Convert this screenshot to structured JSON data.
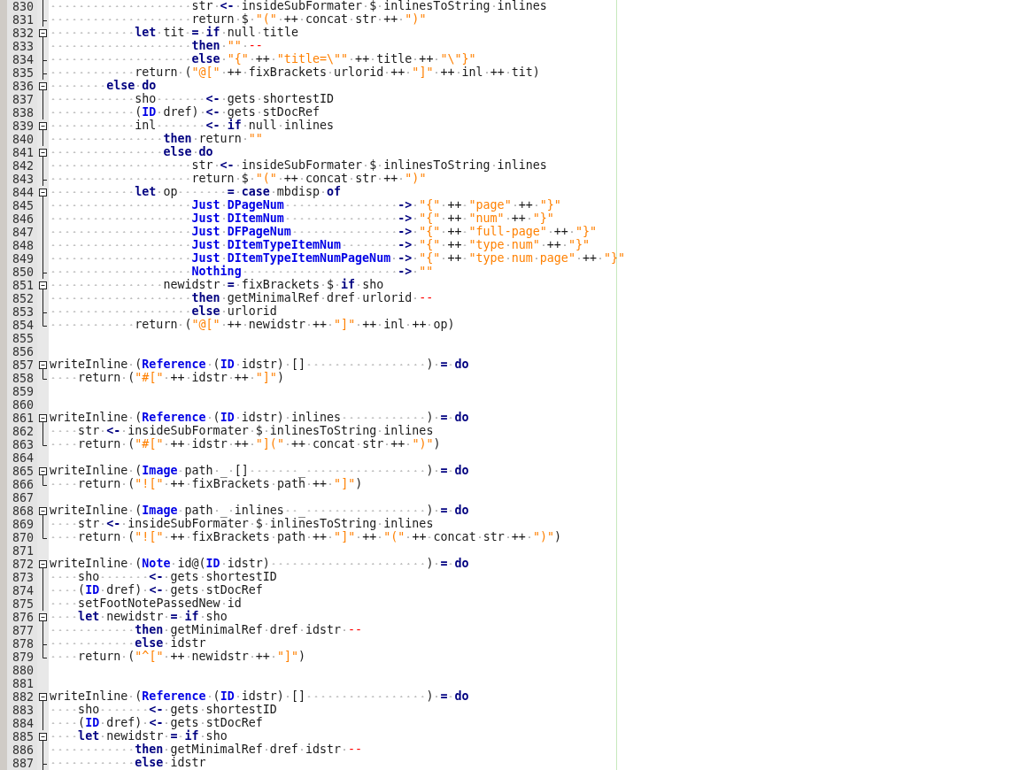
{
  "editor": {
    "lines": [
      {
        "number": "830",
        "fold_marker": {
          "kind": "body"
        },
        "tokens": [
          {
            "kind": "plain",
            "text": "                    str "
          },
          {
            "kind": "keyword",
            "text": "<-"
          },
          {
            "kind": "plain",
            "text": " insideSubFormater $ inlinesToString inlines"
          }
        ]
      },
      {
        "number": "831",
        "fold_marker": {
          "kind": "tee"
        },
        "tokens": [
          {
            "kind": "plain",
            "text": "                    return $ "
          },
          {
            "kind": "string",
            "text": "\"(\""
          },
          {
            "kind": "plain",
            "text": " ++ concat str ++ "
          },
          {
            "kind": "string",
            "text": "\")\""
          }
        ]
      },
      {
        "number": "832",
        "fold_marker": {
          "kind": "start"
        },
        "tokens": [
          {
            "kind": "keyword",
            "text": "            let"
          },
          {
            "kind": "plain",
            "text": " tit "
          },
          {
            "kind": "keyword",
            "text": "="
          },
          {
            "kind": "keyword",
            "text": " if"
          },
          {
            "kind": "plain",
            "text": " null title"
          }
        ]
      },
      {
        "number": "833",
        "fold_marker": {
          "kind": "body"
        },
        "tokens": [
          {
            "kind": "keyword",
            "text": "                    then"
          },
          {
            "kind": "string",
            "text": " \"\""
          },
          {
            "kind": "comment",
            "text": " --"
          }
        ]
      },
      {
        "number": "834",
        "fold_marker": {
          "kind": "tee"
        },
        "tokens": [
          {
            "kind": "keyword",
            "text": "                    else"
          },
          {
            "kind": "string",
            "text": " \"{\""
          },
          {
            "kind": "plain",
            "text": " ++ "
          },
          {
            "kind": "string",
            "text": "\"title=\\\"\""
          },
          {
            "kind": "plain",
            "text": " ++ title ++ "
          },
          {
            "kind": "string",
            "text": "\"\\\"}\""
          }
        ]
      },
      {
        "number": "835",
        "fold_marker": {
          "kind": "tee"
        },
        "tokens": [
          {
            "kind": "plain",
            "text": "            return ("
          },
          {
            "kind": "string",
            "text": "\"@[\""
          },
          {
            "kind": "plain",
            "text": " ++ fixBrackets urlorid ++ "
          },
          {
            "kind": "string",
            "text": "\"]\""
          },
          {
            "kind": "plain",
            "text": " ++ inl ++ tit)"
          }
        ]
      },
      {
        "number": "836",
        "fold_marker": {
          "kind": "start"
        },
        "tokens": [
          {
            "kind": "keyword",
            "text": "        else do"
          }
        ]
      },
      {
        "number": "837",
        "fold_marker": {
          "kind": "body"
        },
        "tokens": [
          {
            "kind": "plain",
            "text": "            sho       "
          },
          {
            "kind": "keyword",
            "text": "<-"
          },
          {
            "kind": "plain",
            "text": " gets shortestID"
          }
        ]
      },
      {
        "number": "838",
        "fold_marker": {
          "kind": "body"
        },
        "tokens": [
          {
            "kind": "plain",
            "text": "            ("
          },
          {
            "kind": "constructor",
            "text": "ID"
          },
          {
            "kind": "plain",
            "text": " dref) "
          },
          {
            "kind": "keyword",
            "text": "<-"
          },
          {
            "kind": "plain",
            "text": " gets stDocRef"
          }
        ]
      },
      {
        "number": "839",
        "fold_marker": {
          "kind": "start"
        },
        "tokens": [
          {
            "kind": "plain",
            "text": "            inl       "
          },
          {
            "kind": "keyword",
            "text": "<- if"
          },
          {
            "kind": "plain",
            "text": " null inlines"
          }
        ]
      },
      {
        "number": "840",
        "fold_marker": {
          "kind": "body"
        },
        "tokens": [
          {
            "kind": "keyword",
            "text": "                then"
          },
          {
            "kind": "plain",
            "text": " return "
          },
          {
            "kind": "string",
            "text": "\"\""
          }
        ]
      },
      {
        "number": "841",
        "fold_marker": {
          "kind": "start"
        },
        "tokens": [
          {
            "kind": "keyword",
            "text": "                else do"
          }
        ]
      },
      {
        "number": "842",
        "fold_marker": {
          "kind": "body"
        },
        "tokens": [
          {
            "kind": "plain",
            "text": "                    str "
          },
          {
            "kind": "keyword",
            "text": "<-"
          },
          {
            "kind": "plain",
            "text": " insideSubFormater $ inlinesToString inlines"
          }
        ]
      },
      {
        "number": "843",
        "fold_marker": {
          "kind": "tee"
        },
        "tokens": [
          {
            "kind": "plain",
            "text": "                    return $ "
          },
          {
            "kind": "string",
            "text": "\"(\""
          },
          {
            "kind": "plain",
            "text": " ++ concat str ++ "
          },
          {
            "kind": "string",
            "text": "\")\""
          }
        ]
      },
      {
        "number": "844",
        "fold_marker": {
          "kind": "start"
        },
        "tokens": [
          {
            "kind": "keyword",
            "text": "            let"
          },
          {
            "kind": "plain",
            "text": " op       "
          },
          {
            "kind": "keyword",
            "text": "= case"
          },
          {
            "kind": "plain",
            "text": " mbdisp "
          },
          {
            "kind": "keyword",
            "text": "of"
          }
        ]
      },
      {
        "number": "845",
        "fold_marker": {
          "kind": "body"
        },
        "tokens": [
          {
            "kind": "constructor",
            "text": "                    Just DPageNum"
          },
          {
            "kind": "keyword",
            "text": "                ->"
          },
          {
            "kind": "string",
            "text": " \"{\""
          },
          {
            "kind": "plain",
            "text": " ++ "
          },
          {
            "kind": "string",
            "text": "\"page\""
          },
          {
            "kind": "plain",
            "text": " ++ "
          },
          {
            "kind": "string",
            "text": "\"}\""
          }
        ]
      },
      {
        "number": "846",
        "fold_marker": {
          "kind": "body"
        },
        "tokens": [
          {
            "kind": "constructor",
            "text": "                    Just DItemNum"
          },
          {
            "kind": "keyword",
            "text": "                ->"
          },
          {
            "kind": "string",
            "text": " \"{\""
          },
          {
            "kind": "plain",
            "text": " ++ "
          },
          {
            "kind": "string",
            "text": "\"num\""
          },
          {
            "kind": "plain",
            "text": " ++ "
          },
          {
            "kind": "string",
            "text": "\"}\""
          }
        ]
      },
      {
        "number": "847",
        "fold_marker": {
          "kind": "body"
        },
        "tokens": [
          {
            "kind": "constructor",
            "text": "                    Just DFPageNum"
          },
          {
            "kind": "keyword",
            "text": "               ->"
          },
          {
            "kind": "string",
            "text": " \"{\""
          },
          {
            "kind": "plain",
            "text": " ++ "
          },
          {
            "kind": "string",
            "text": "\"full-page\""
          },
          {
            "kind": "plain",
            "text": " ++ "
          },
          {
            "kind": "string",
            "text": "\"}\""
          }
        ]
      },
      {
        "number": "848",
        "fold_marker": {
          "kind": "body"
        },
        "tokens": [
          {
            "kind": "constructor",
            "text": "                    Just DItemTypeItemNum"
          },
          {
            "kind": "keyword",
            "text": "        ->"
          },
          {
            "kind": "string",
            "text": " \"{\""
          },
          {
            "kind": "plain",
            "text": " ++ "
          },
          {
            "kind": "string",
            "text": "\"type num\""
          },
          {
            "kind": "plain",
            "text": " ++ "
          },
          {
            "kind": "string",
            "text": "\"}\""
          }
        ]
      },
      {
        "number": "849",
        "fold_marker": {
          "kind": "body"
        },
        "tokens": [
          {
            "kind": "constructor",
            "text": "                    Just DItemTypeItemNumPageNum"
          },
          {
            "kind": "keyword",
            "text": " ->"
          },
          {
            "kind": "string",
            "text": " \"{\""
          },
          {
            "kind": "plain",
            "text": " ++ "
          },
          {
            "kind": "string",
            "text": "\"type num page\""
          },
          {
            "kind": "plain",
            "text": " ++ "
          },
          {
            "kind": "string",
            "text": "\"}\""
          }
        ]
      },
      {
        "number": "850",
        "fold_marker": {
          "kind": "tee"
        },
        "tokens": [
          {
            "kind": "constructor",
            "text": "                    Nothing"
          },
          {
            "kind": "keyword",
            "text": "                      ->"
          },
          {
            "kind": "string",
            "text": " \"\""
          }
        ]
      },
      {
        "number": "851",
        "fold_marker": {
          "kind": "start"
        },
        "tokens": [
          {
            "kind": "plain",
            "text": "                newidstr "
          },
          {
            "kind": "keyword",
            "text": "="
          },
          {
            "kind": "plain",
            "text": " fixBrackets $ "
          },
          {
            "kind": "keyword",
            "text": "if"
          },
          {
            "kind": "plain",
            "text": " sho"
          }
        ]
      },
      {
        "number": "852",
        "fold_marker": {
          "kind": "body"
        },
        "tokens": [
          {
            "kind": "keyword",
            "text": "                    then"
          },
          {
            "kind": "plain",
            "text": " getMinimalRef dref urlorid "
          },
          {
            "kind": "comment",
            "text": "--"
          }
        ]
      },
      {
        "number": "853",
        "fold_marker": {
          "kind": "tee"
        },
        "tokens": [
          {
            "kind": "keyword",
            "text": "                    else"
          },
          {
            "kind": "plain",
            "text": " urlorid"
          }
        ]
      },
      {
        "number": "854",
        "fold_marker": {
          "kind": "end"
        },
        "tokens": [
          {
            "kind": "plain",
            "text": "            return ("
          },
          {
            "kind": "string",
            "text": "\"@[\""
          },
          {
            "kind": "plain",
            "text": " ++ newidstr ++ "
          },
          {
            "kind": "string",
            "text": "\"]\""
          },
          {
            "kind": "plain",
            "text": " ++ inl ++ op)"
          }
        ]
      },
      {
        "number": "855"
      },
      {
        "number": "856"
      },
      {
        "number": "857",
        "fold_marker": {
          "kind": "start"
        },
        "tokens": [
          {
            "kind": "plain",
            "text": "writeInline ("
          },
          {
            "kind": "constructor",
            "text": "Reference"
          },
          {
            "kind": "plain",
            "text": " ("
          },
          {
            "kind": "constructor",
            "text": "ID"
          },
          {
            "kind": "plain",
            "text": " idstr) []                 ) "
          },
          {
            "kind": "keyword",
            "text": "= do"
          }
        ]
      },
      {
        "number": "858",
        "fold_marker": {
          "kind": "end"
        },
        "tokens": [
          {
            "kind": "plain",
            "text": "    return ("
          },
          {
            "kind": "string",
            "text": "\"#[\""
          },
          {
            "kind": "plain",
            "text": " ++ idstr ++ "
          },
          {
            "kind": "string",
            "text": "\"]\""
          },
          {
            "kind": "plain",
            "text": ")"
          }
        ]
      },
      {
        "number": "859"
      },
      {
        "number": "860"
      },
      {
        "number": "861",
        "fold_marker": {
          "kind": "start"
        },
        "tokens": [
          {
            "kind": "plain",
            "text": "writeInline ("
          },
          {
            "kind": "constructor",
            "text": "Reference"
          },
          {
            "kind": "plain",
            "text": " ("
          },
          {
            "kind": "constructor",
            "text": "ID"
          },
          {
            "kind": "plain",
            "text": " idstr) inlines            ) "
          },
          {
            "kind": "keyword",
            "text": "= do"
          }
        ]
      },
      {
        "number": "862",
        "fold_marker": {
          "kind": "body"
        },
        "tokens": [
          {
            "kind": "plain",
            "text": "    str "
          },
          {
            "kind": "keyword",
            "text": "<-"
          },
          {
            "kind": "plain",
            "text": " insideSubFormater $ inlinesToString inlines"
          }
        ]
      },
      {
        "number": "863",
        "fold_marker": {
          "kind": "end"
        },
        "tokens": [
          {
            "kind": "plain",
            "text": "    return ("
          },
          {
            "kind": "string",
            "text": "\"#[\""
          },
          {
            "kind": "plain",
            "text": " ++ idstr ++ "
          },
          {
            "kind": "string",
            "text": "\"](\""
          },
          {
            "kind": "plain",
            "text": " ++ concat str ++ "
          },
          {
            "kind": "string",
            "text": "\")\""
          },
          {
            "kind": "plain",
            "text": ")"
          }
        ]
      },
      {
        "number": "864"
      },
      {
        "number": "865",
        "fold_marker": {
          "kind": "start"
        },
        "tokens": [
          {
            "kind": "plain",
            "text": "writeInline ("
          },
          {
            "kind": "constructor",
            "text": "Image"
          },
          {
            "kind": "plain",
            "text": " path _ []       _                 ) "
          },
          {
            "kind": "keyword",
            "text": "= do"
          }
        ]
      },
      {
        "number": "866",
        "fold_marker": {
          "kind": "end"
        },
        "tokens": [
          {
            "kind": "plain",
            "text": "    return ("
          },
          {
            "kind": "string",
            "text": "\"![\""
          },
          {
            "kind": "plain",
            "text": " ++ fixBrackets path ++ "
          },
          {
            "kind": "string",
            "text": "\"]\""
          },
          {
            "kind": "plain",
            "text": ")"
          }
        ]
      },
      {
        "number": "867"
      },
      {
        "number": "868",
        "fold_marker": {
          "kind": "start"
        },
        "tokens": [
          {
            "kind": "plain",
            "text": "writeInline ("
          },
          {
            "kind": "constructor",
            "text": "Image"
          },
          {
            "kind": "plain",
            "text": " path _ inlines  _                 ) "
          },
          {
            "kind": "keyword",
            "text": "= do"
          }
        ]
      },
      {
        "number": "869",
        "fold_marker": {
          "kind": "body"
        },
        "tokens": [
          {
            "kind": "plain",
            "text": "    str "
          },
          {
            "kind": "keyword",
            "text": "<-"
          },
          {
            "kind": "plain",
            "text": " insideSubFormater $ inlinesToString inlines"
          }
        ]
      },
      {
        "number": "870",
        "fold_marker": {
          "kind": "end"
        },
        "tokens": [
          {
            "kind": "plain",
            "text": "    return ("
          },
          {
            "kind": "string",
            "text": "\"![\""
          },
          {
            "kind": "plain",
            "text": " ++ fixBrackets path ++ "
          },
          {
            "kind": "string",
            "text": "\"]\""
          },
          {
            "kind": "plain",
            "text": " ++ "
          },
          {
            "kind": "string",
            "text": "\"(\""
          },
          {
            "kind": "plain",
            "text": " ++ concat str ++ "
          },
          {
            "kind": "string",
            "text": "\")\""
          },
          {
            "kind": "plain",
            "text": ")"
          }
        ]
      },
      {
        "number": "871"
      },
      {
        "number": "872",
        "fold_marker": {
          "kind": "start"
        },
        "tokens": [
          {
            "kind": "plain",
            "text": "writeInline ("
          },
          {
            "kind": "constructor",
            "text": "Note"
          },
          {
            "kind": "plain",
            "text": " id@("
          },
          {
            "kind": "constructor",
            "text": "ID"
          },
          {
            "kind": "plain",
            "text": " idstr)                      ) "
          },
          {
            "kind": "keyword",
            "text": "= do"
          }
        ]
      },
      {
        "number": "873",
        "fold_marker": {
          "kind": "body"
        },
        "tokens": [
          {
            "kind": "plain",
            "text": "    sho       "
          },
          {
            "kind": "keyword",
            "text": "<-"
          },
          {
            "kind": "plain",
            "text": " gets shortestID"
          }
        ]
      },
      {
        "number": "874",
        "fold_marker": {
          "kind": "body"
        },
        "tokens": [
          {
            "kind": "plain",
            "text": "    ("
          },
          {
            "kind": "constructor",
            "text": "ID"
          },
          {
            "kind": "plain",
            "text": " dref) "
          },
          {
            "kind": "keyword",
            "text": "<-"
          },
          {
            "kind": "plain",
            "text": " gets stDocRef"
          }
        ]
      },
      {
        "number": "875",
        "fold_marker": {
          "kind": "body"
        },
        "tokens": [
          {
            "kind": "plain",
            "text": "    setFootNotePassedNew id"
          }
        ]
      },
      {
        "number": "876",
        "fold_marker": {
          "kind": "start"
        },
        "tokens": [
          {
            "kind": "keyword",
            "text": "    let"
          },
          {
            "kind": "plain",
            "text": " newidstr "
          },
          {
            "kind": "keyword",
            "text": "= if"
          },
          {
            "kind": "plain",
            "text": " sho"
          }
        ]
      },
      {
        "number": "877",
        "fold_marker": {
          "kind": "body"
        },
        "tokens": [
          {
            "kind": "keyword",
            "text": "            then"
          },
          {
            "kind": "plain",
            "text": " getMinimalRef dref idstr "
          },
          {
            "kind": "comment",
            "text": "--"
          }
        ]
      },
      {
        "number": "878",
        "fold_marker": {
          "kind": "tee"
        },
        "tokens": [
          {
            "kind": "keyword",
            "text": "            else"
          },
          {
            "kind": "plain",
            "text": " idstr"
          }
        ]
      },
      {
        "number": "879",
        "fold_marker": {
          "kind": "end"
        },
        "tokens": [
          {
            "kind": "plain",
            "text": "    return ("
          },
          {
            "kind": "string",
            "text": "\"^[\""
          },
          {
            "kind": "plain",
            "text": " ++ newidstr ++ "
          },
          {
            "kind": "string",
            "text": "\"]\""
          },
          {
            "kind": "plain",
            "text": ")"
          }
        ]
      },
      {
        "number": "880"
      },
      {
        "number": "881"
      },
      {
        "number": "882",
        "fold_marker": {
          "kind": "start"
        },
        "tokens": [
          {
            "kind": "plain",
            "text": "writeInline ("
          },
          {
            "kind": "constructor",
            "text": "Reference"
          },
          {
            "kind": "plain",
            "text": " ("
          },
          {
            "kind": "constructor",
            "text": "ID"
          },
          {
            "kind": "plain",
            "text": " idstr) []                 ) "
          },
          {
            "kind": "keyword",
            "text": "= do"
          }
        ]
      },
      {
        "number": "883",
        "fold_marker": {
          "kind": "body"
        },
        "tokens": [
          {
            "kind": "plain",
            "text": "    sho       "
          },
          {
            "kind": "keyword",
            "text": "<-"
          },
          {
            "kind": "plain",
            "text": " gets shortestID"
          }
        ]
      },
      {
        "number": "884",
        "fold_marker": {
          "kind": "body"
        },
        "tokens": [
          {
            "kind": "plain",
            "text": "    ("
          },
          {
            "kind": "constructor",
            "text": "ID"
          },
          {
            "kind": "plain",
            "text": " dref) "
          },
          {
            "kind": "keyword",
            "text": "<-"
          },
          {
            "kind": "plain",
            "text": " gets stDocRef"
          }
        ]
      },
      {
        "number": "885",
        "fold_marker": {
          "kind": "start"
        },
        "tokens": [
          {
            "kind": "keyword",
            "text": "    let"
          },
          {
            "kind": "plain",
            "text": " newidstr "
          },
          {
            "kind": "keyword",
            "text": "= if"
          },
          {
            "kind": "plain",
            "text": " sho"
          }
        ]
      },
      {
        "number": "886",
        "fold_marker": {
          "kind": "body"
        },
        "tokens": [
          {
            "kind": "keyword",
            "text": "            then"
          },
          {
            "kind": "plain",
            "text": " getMinimalRef dref idstr "
          },
          {
            "kind": "comment",
            "text": "--"
          }
        ]
      },
      {
        "number": "887",
        "fold_marker": {
          "kind": "tee"
        },
        "tokens": [
          {
            "kind": "keyword",
            "text": "            else"
          },
          {
            "kind": "plain",
            "text": " idstr"
          }
        ]
      }
    ]
  }
}
